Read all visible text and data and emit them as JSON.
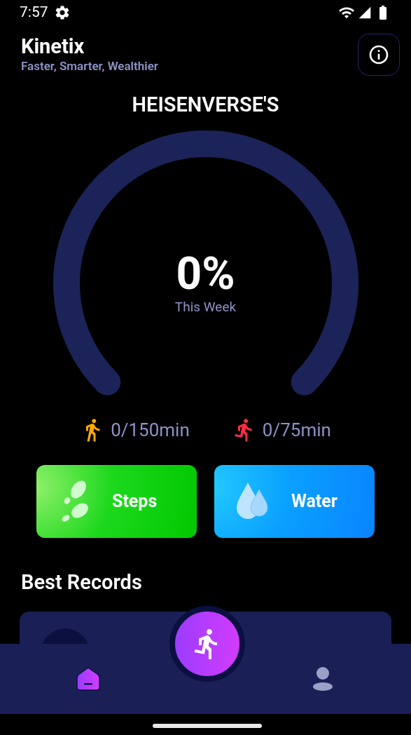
{
  "status_bar": {
    "time": "7:57"
  },
  "header": {
    "title": "Kinetix",
    "subtitle": "Faster, Smarter, Wealthier"
  },
  "user_title": "HEISENVERSE'S",
  "gauge": {
    "value": "0%",
    "caption": "This Week"
  },
  "goals": [
    {
      "kind": "walk",
      "color": "#ffa800",
      "text": "0/150min"
    },
    {
      "kind": "run",
      "color": "#ff2d45",
      "text": "0/75min"
    }
  ],
  "actions": [
    {
      "kind": "steps",
      "label": "Steps"
    },
    {
      "kind": "water",
      "label": "Water"
    }
  ],
  "section_title": "Best Records",
  "nav": [
    {
      "kind": "home",
      "selected": true
    },
    {
      "kind": "profile",
      "selected": false
    }
  ]
}
